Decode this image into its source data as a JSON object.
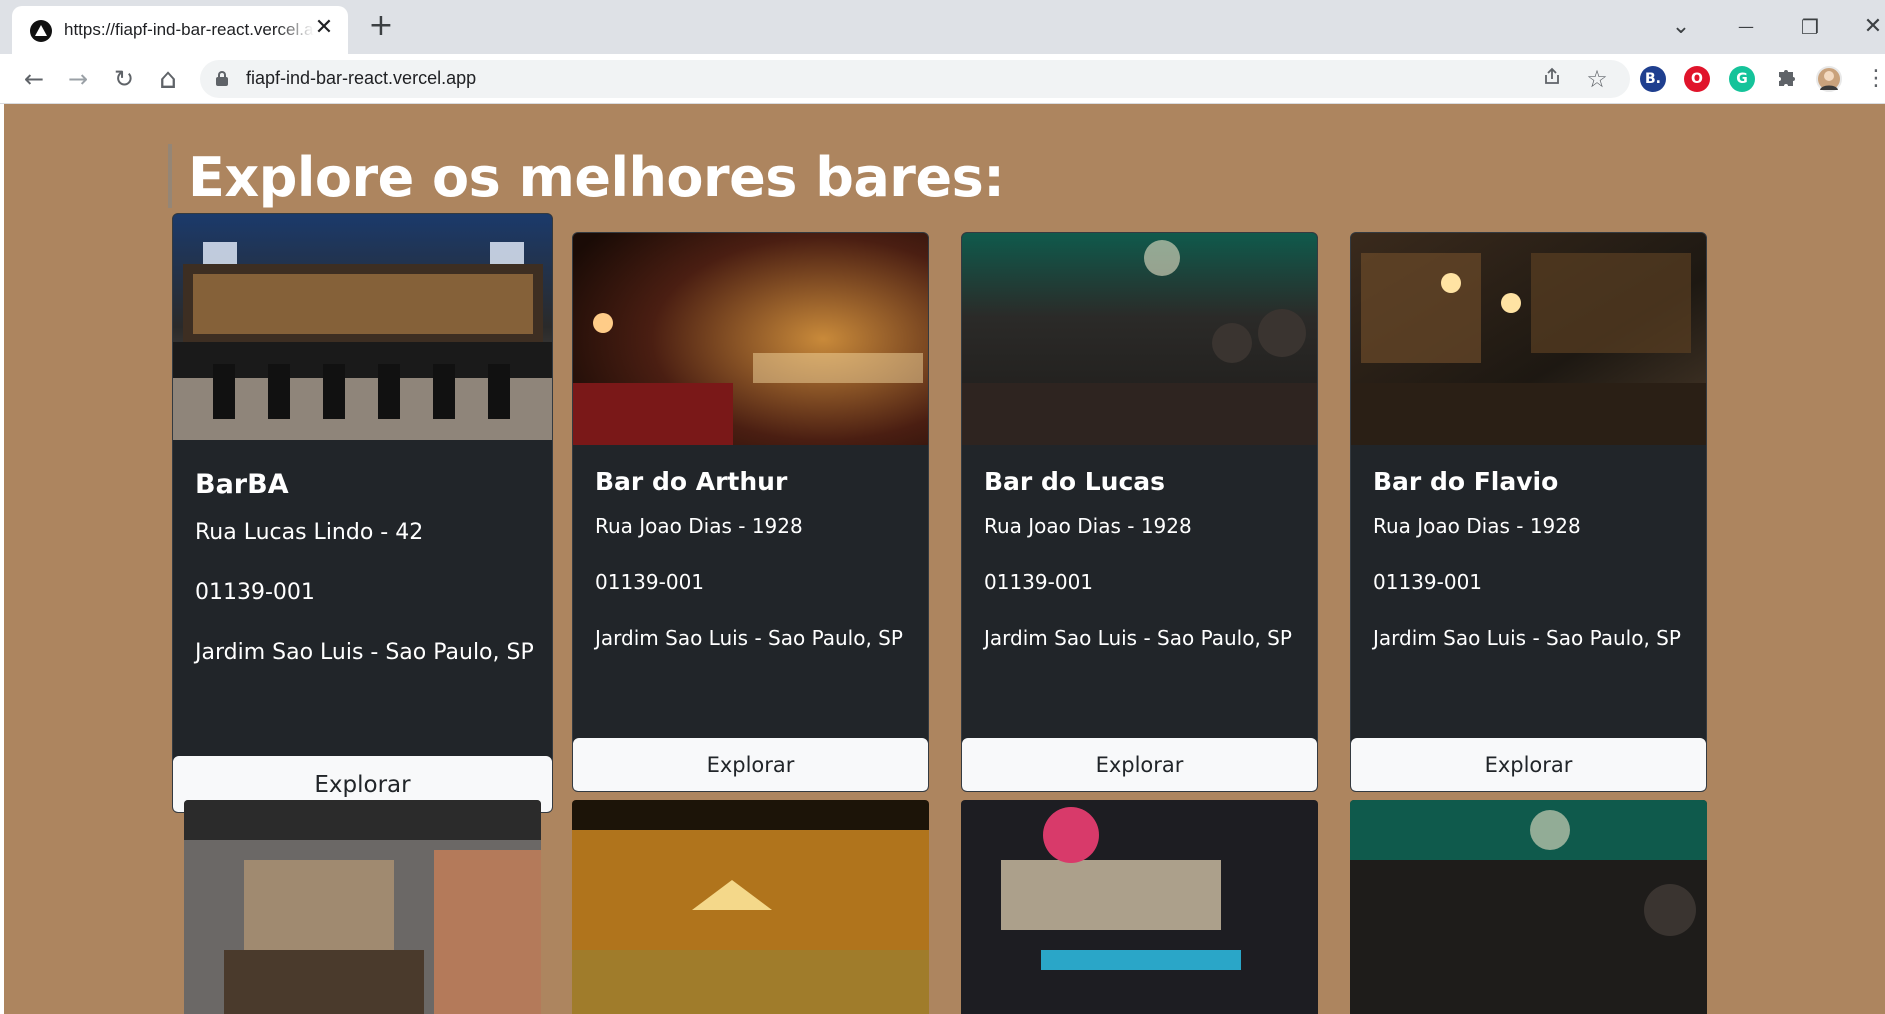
{
  "browser": {
    "tab_title": "https://fiapf-ind-bar-react.vercel.app",
    "tab_close": "✕",
    "new_tab": "+",
    "url": "fiapf-ind-bar-react.vercel.app",
    "window_controls": {
      "dropdown": "⌄",
      "minimize": "—",
      "restore": "❐",
      "close": "✕"
    },
    "nav": {
      "back": "←",
      "forward": "→",
      "reload": "↻",
      "home": "⌂"
    },
    "omnibox_icons": {
      "share": "share-icon",
      "bookmark": "☆"
    },
    "extensions": [
      {
        "name": "booking-extension-icon",
        "label": "B.",
        "color": "#1f3f8f"
      },
      {
        "name": "opera-extension-icon",
        "label": "O",
        "color": "#e0142b"
      },
      {
        "name": "grammarly-extension-icon",
        "label": "G",
        "color": "#15c39a"
      }
    ],
    "menu": "⋮"
  },
  "page": {
    "title": "Explore os melhores bares:",
    "explore_label": "Explorar",
    "bars": [
      {
        "name": "BarBA",
        "address": "Rua Lucas Lindo - 42",
        "cep": "01139-001",
        "district": "Jardim Sao Luis - Sao Paulo, SP"
      },
      {
        "name": "Bar do Arthur",
        "address": "Rua Joao Dias - 1928",
        "cep": "01139-001",
        "district": "Jardim Sao Luis - Sao Paulo, SP"
      },
      {
        "name": "Bar do Lucas",
        "address": "Rua Joao Dias - 1928",
        "cep": "01139-001",
        "district": "Jardim Sao Luis - Sao Paulo, SP"
      },
      {
        "name": "Bar do Flavio",
        "address": "Rua Joao Dias - 1928",
        "cep": "01139-001",
        "district": "Jardim Sao Luis - Sao Paulo, SP"
      }
    ]
  },
  "colors": {
    "page_background": "#ad855f",
    "card_background": "#212529",
    "button_background": "#f8f9fa"
  }
}
